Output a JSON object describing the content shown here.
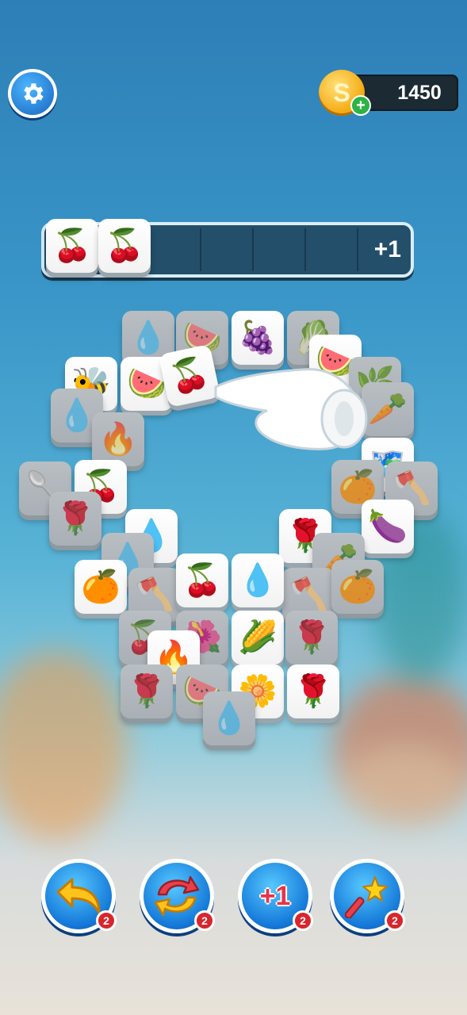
{
  "header": {
    "settings_icon": "gear-icon",
    "coin_balance": "1450",
    "coin_icon": "coin-icon",
    "coin_symbol": "S",
    "coin_add_label": "+"
  },
  "tray": {
    "extra_slot_label": "+1",
    "collected": [
      "🍒",
      "🍒"
    ]
  },
  "board": {
    "highlight_tile": "🍒"
  },
  "boosters": [
    {
      "name": "undo",
      "icon": "undo-arrow-icon",
      "count": "2"
    },
    {
      "name": "shuffle",
      "icon": "shuffle-icon",
      "count": "2"
    },
    {
      "name": "add-slot",
      "icon": "plus-one-icon",
      "label": "+1",
      "count": "2"
    },
    {
      "name": "magic-wand",
      "icon": "magic-wand-icon",
      "count": "2"
    }
  ],
  "colors": {
    "accent": "#1a7fd8",
    "badge": "#d8262c",
    "tray": "#244f6b"
  }
}
